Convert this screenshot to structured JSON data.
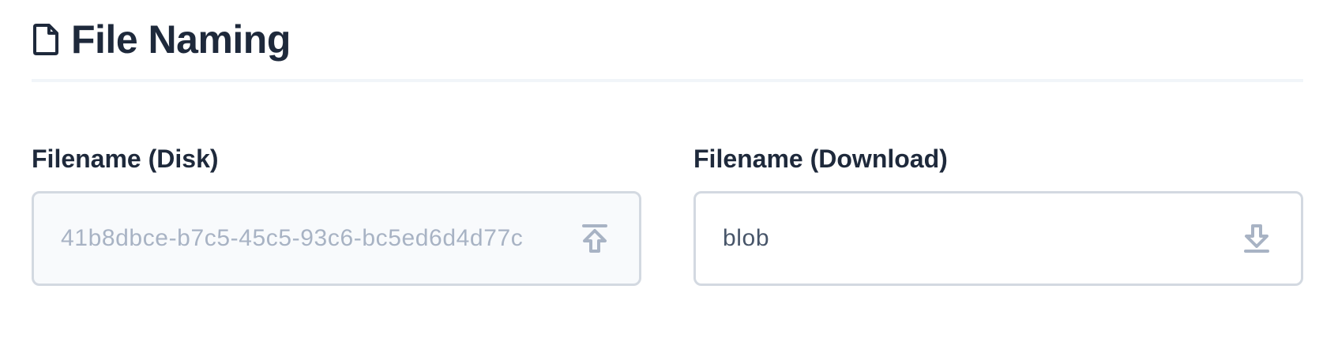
{
  "section": {
    "title": "File Naming",
    "icon": "file-icon"
  },
  "fields": {
    "disk": {
      "label": "Filename (Disk)",
      "value": "41b8dbce-b7c5-45c5-93c6-bc5ed6d4d77c",
      "action_icon": "upload-icon",
      "readonly": true
    },
    "download": {
      "label": "Filename (Download)",
      "value": "blob",
      "action_icon": "download-icon",
      "readonly": false
    }
  },
  "colors": {
    "heading": "#1e293b",
    "divider": "#f1f5f9",
    "input_border": "#d3d9e1",
    "readonly_bg": "#f8fafc",
    "readonly_text": "#a8b3c4",
    "value_text": "#475569",
    "icon": "#a8b3c4"
  }
}
